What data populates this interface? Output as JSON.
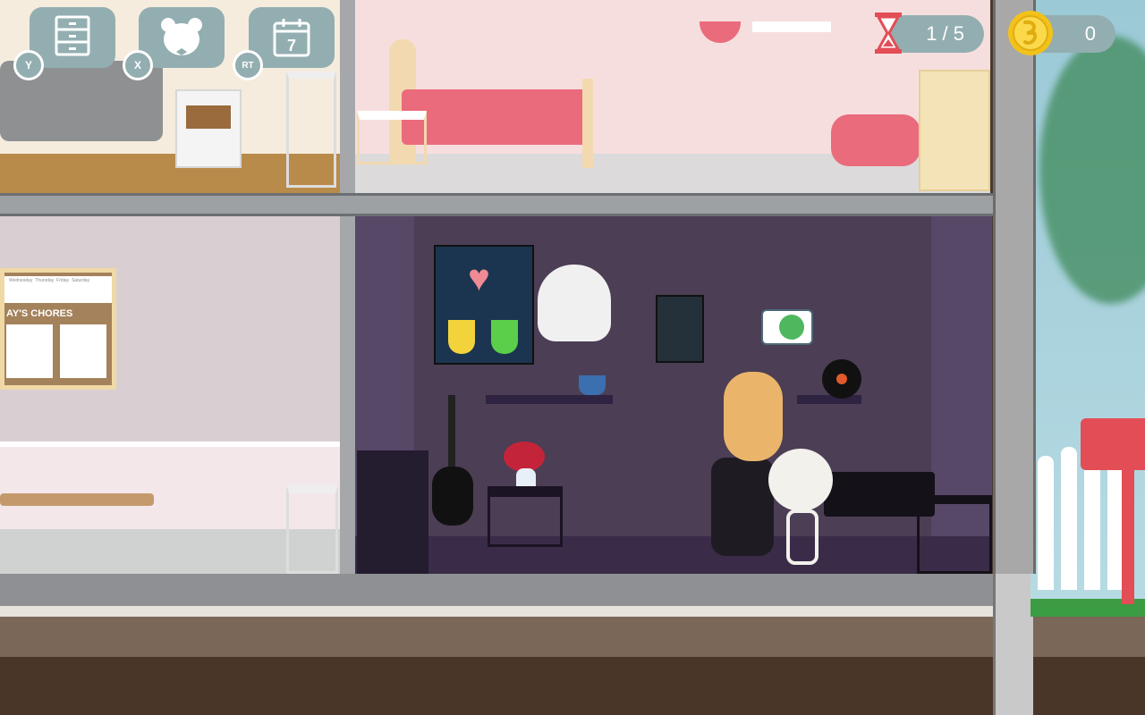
{
  "hud": {
    "buttons": [
      {
        "icon": "drawer-cabinet-icon",
        "key": "Y"
      },
      {
        "icon": "bear-face-icon",
        "key": "X"
      },
      {
        "icon": "calendar-icon",
        "key": "RT",
        "calendar_day": "7"
      }
    ],
    "timer": {
      "icon": "hourglass-icon",
      "value": "1 / 5"
    },
    "coins": {
      "icon": "coin-icon",
      "value": "0"
    }
  },
  "scene": {
    "chores_board_title": "AY'S CHORES",
    "chores_days": [
      "",
      "Wednesday",
      "Thursday",
      "Friday",
      "Saturday"
    ]
  },
  "colors": {
    "hud_bg": "#93aeb0",
    "purple_room_wall": "#4b3e55",
    "pink_room_wall": "#f7dede",
    "accent_pink": "#ea6b7b",
    "coin": "#f2c21b"
  }
}
